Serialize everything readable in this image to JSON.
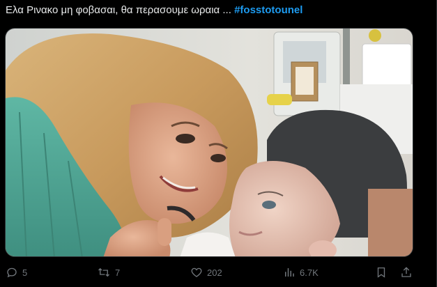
{
  "post": {
    "text": "Ελα Ρινακο μη φοβασαι, θα περασουμε ωραια ... ",
    "hashtag": "#fosstotounel"
  },
  "media": {
    "alt_icon": "photo"
  },
  "actions": {
    "replies": "5",
    "reposts": "7",
    "likes": "202",
    "views": "6.7K"
  },
  "icons": {
    "reply": "reply-icon",
    "repost": "repost-icon",
    "like": "heart-icon",
    "views": "views-icon",
    "bookmark": "bookmark-icon",
    "share": "share-icon"
  },
  "colors": {
    "background": "#000000",
    "text": "#e7e9ea",
    "hashtag": "#1d9bf0",
    "muted": "#71767b"
  }
}
